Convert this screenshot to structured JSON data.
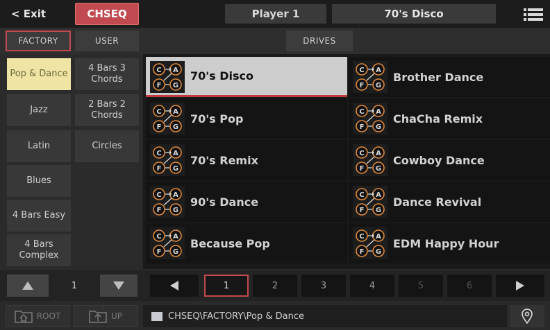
{
  "header": {
    "exit_label": "< Exit",
    "mode_label": "CHSEQ",
    "player_label": "Player 1",
    "current_style": "70's Disco",
    "menu_icon": "hamburger-menu-icon"
  },
  "tabs": {
    "factory_label": "FACTORY",
    "user_label": "USER",
    "drives_label": "DRIVES"
  },
  "categories": [
    {
      "label": "Pop & Dance",
      "selected": true
    },
    {
      "label": "4 Bars 3 Chords",
      "selected": false
    },
    {
      "label": "Jazz",
      "selected": false
    },
    {
      "label": "2 Bars 2 Chords",
      "selected": false
    },
    {
      "label": "Latin",
      "selected": false
    },
    {
      "label": "Circles",
      "selected": false
    },
    {
      "label": "Blues",
      "selected": false
    },
    {
      "label": "4 Bars Easy",
      "selected": false
    },
    {
      "label": "4 Bars Complex",
      "selected": false
    }
  ],
  "chord_icon_letters": [
    "C",
    "A",
    "F",
    "G"
  ],
  "items": [
    {
      "name": "70's Disco",
      "selected": true
    },
    {
      "name": "Brother Dance",
      "selected": false
    },
    {
      "name": "70's Pop",
      "selected": false
    },
    {
      "name": "ChaCha Remix",
      "selected": false
    },
    {
      "name": "70's Remix",
      "selected": false
    },
    {
      "name": "Cowboy Dance",
      "selected": false
    },
    {
      "name": "90's Dance",
      "selected": false
    },
    {
      "name": "Dance Revival",
      "selected": false
    },
    {
      "name": "Because Pop",
      "selected": false
    },
    {
      "name": "EDM Happy Hour",
      "selected": false
    }
  ],
  "category_scroll": {
    "page": "1"
  },
  "pages": [
    {
      "label": "1",
      "state": "current"
    },
    {
      "label": "2",
      "state": "normal"
    },
    {
      "label": "3",
      "state": "normal"
    },
    {
      "label": "4",
      "state": "normal"
    },
    {
      "label": "5",
      "state": "disabled"
    },
    {
      "label": "6",
      "state": "disabled"
    }
  ],
  "footer": {
    "root_label": "ROOT",
    "up_label": "UP",
    "path": "CHSEQ\\FACTORY\\Pop & Dance"
  },
  "colors": {
    "accent_red": "#c14a50",
    "selected_category": "#efe4a4",
    "selected_item": "#cdcdcd",
    "icon_orange": "#e08a3c"
  }
}
